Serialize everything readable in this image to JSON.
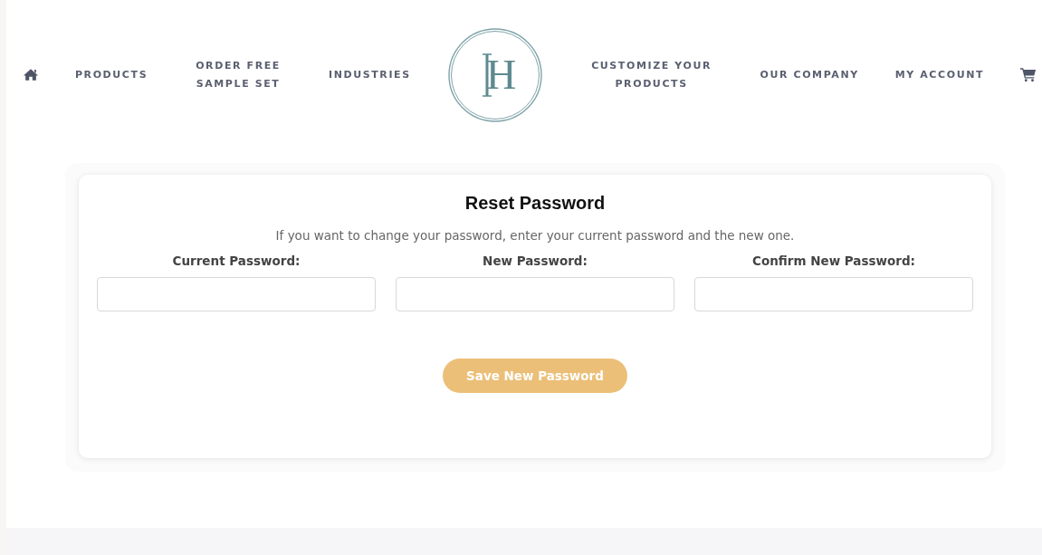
{
  "nav": {
    "left": [
      {
        "label": "PRODUCTS"
      },
      {
        "label": "ORDER FREE SAMPLE SET"
      },
      {
        "label": "INDUSTRIES"
      }
    ],
    "logo": {
      "text": "H"
    },
    "right": [
      {
        "label": "CUSTOMIZE YOUR PRODUCTS"
      },
      {
        "label": "OUR COMPANY"
      },
      {
        "label": "MY ACCOUNT"
      }
    ]
  },
  "form": {
    "title": "Reset Password",
    "description": "If you want to change your password, enter your current password and the new one.",
    "fields": [
      {
        "label": "Current Password:"
      },
      {
        "label": "New Password:"
      },
      {
        "label": "Confirm New Password:"
      }
    ],
    "button": "Save New Password"
  }
}
